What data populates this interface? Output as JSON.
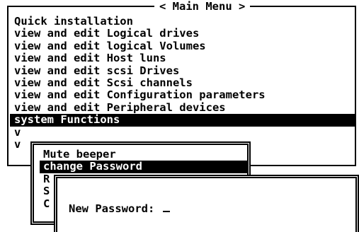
{
  "main_menu": {
    "title": "< Main Menu >",
    "items": [
      {
        "label": "Quick installation",
        "selected": false
      },
      {
        "label": "view and edit Logical drives",
        "selected": false
      },
      {
        "label": "view and edit logical Volumes",
        "selected": false
      },
      {
        "label": "view and edit Host luns",
        "selected": false
      },
      {
        "label": "view and edit scsi Drives",
        "selected": false
      },
      {
        "label": "view and edit Scsi channels",
        "selected": false
      },
      {
        "label": "view and edit Configuration parameters",
        "selected": false
      },
      {
        "label": "view and edit Peripheral devices",
        "selected": false
      },
      {
        "label": "system Functions",
        "selected": true
      },
      {
        "label": "v",
        "selected": false
      },
      {
        "label": "v",
        "selected": false
      }
    ]
  },
  "system_functions_menu": {
    "items": [
      {
        "label": "Mute beeper",
        "selected": false
      },
      {
        "label": "change Password",
        "selected": true
      },
      {
        "label": "R",
        "selected": false
      },
      {
        "label": "S",
        "selected": false
      },
      {
        "label": "C",
        "selected": false
      }
    ]
  },
  "password_dialog": {
    "prompt": "New Password:",
    "value": ""
  },
  "colors": {
    "background": "#ffffff",
    "foreground": "#000000",
    "highlight_background": "#000000",
    "highlight_foreground": "#ffffff"
  }
}
